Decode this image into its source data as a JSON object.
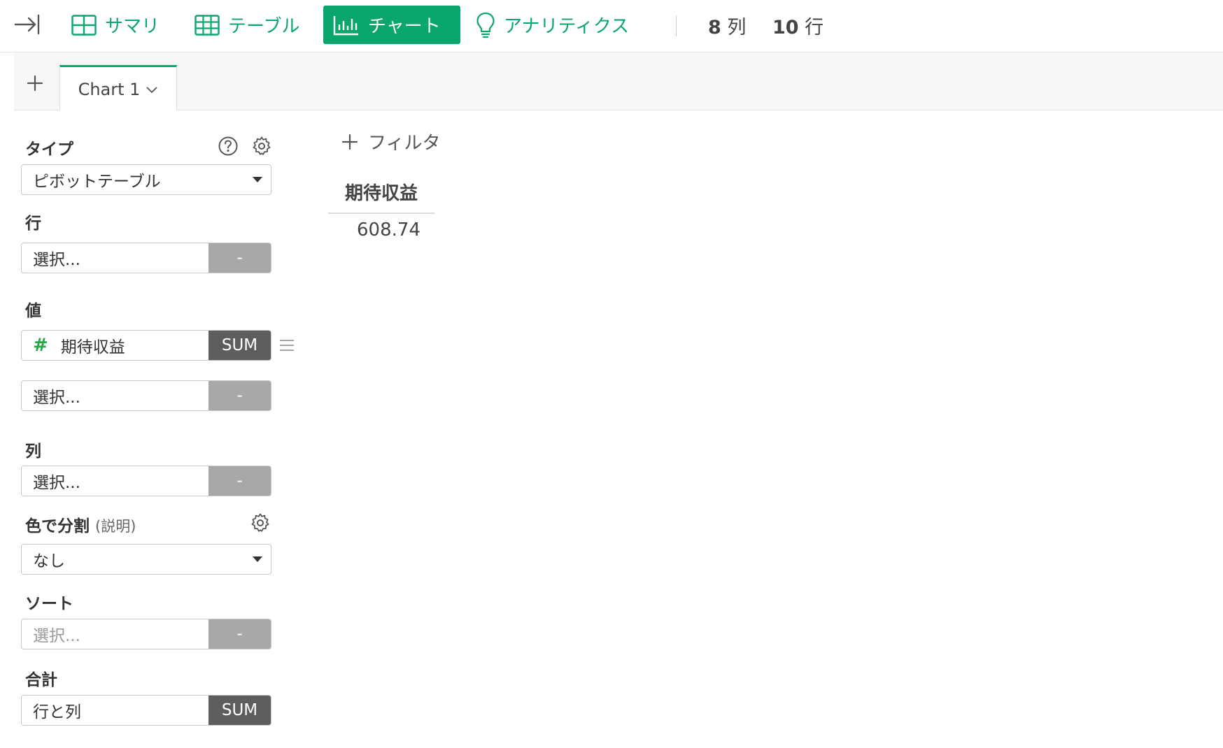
{
  "toolbar": {
    "nav": [
      {
        "label": "サマリ",
        "icon": "grid-icon"
      },
      {
        "label": "テーブル",
        "icon": "table-icon"
      },
      {
        "label": "チャート",
        "icon": "bar-chart-icon",
        "active": true
      },
      {
        "label": "アナリティクス",
        "icon": "lightbulb-icon"
      }
    ],
    "columns": {
      "count": "8",
      "unit": "列"
    },
    "rows": {
      "count": "10",
      "unit": "行"
    }
  },
  "tabs": [
    {
      "label": "Chart 1"
    }
  ],
  "panel": {
    "type": {
      "label": "タイプ",
      "value": "ピボットテーブル"
    },
    "row": {
      "label": "行",
      "placeholder": "選択...",
      "agg": "-"
    },
    "value": {
      "label": "値",
      "items": [
        {
          "field": "期待収益",
          "agg": "SUM"
        },
        {
          "field": "選択...",
          "agg": "-"
        }
      ]
    },
    "column": {
      "label": "列",
      "placeholder": "選択...",
      "agg": "-"
    },
    "color": {
      "label": "色で分割",
      "hint": "(説明)",
      "value": "なし"
    },
    "sort": {
      "label": "ソート",
      "placeholder": "選択...",
      "agg": "-"
    },
    "total": {
      "label": "合計",
      "value": "行と列",
      "agg": "SUM"
    }
  },
  "content": {
    "filter_label": "フィルタ",
    "pivot": {
      "header": "期待収益",
      "value": "608.74"
    }
  },
  "colors": {
    "accent": "#0ba66b",
    "dark_button": "#5d5d5d",
    "muted_button": "#a8a8a8"
  }
}
